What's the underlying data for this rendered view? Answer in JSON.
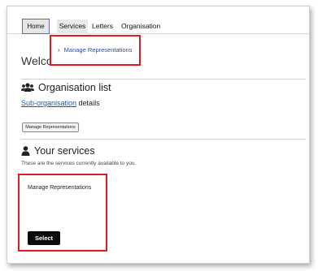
{
  "nav": {
    "items": [
      {
        "label": "Home"
      },
      {
        "label": "Services"
      },
      {
        "label": "Letters"
      },
      {
        "label": "Organisation"
      }
    ]
  },
  "dropdown": {
    "items": [
      {
        "label": "Manage Representations"
      }
    ]
  },
  "main": {
    "welcome_text": "Welco"
  },
  "organisation_section": {
    "title": "Organisation list",
    "link_text": "Sub-organisation",
    "after_link_text": " details",
    "button_label": "Manage Representations"
  },
  "services_section": {
    "title": "Your services",
    "description": "These are the services currently available to you.",
    "card": {
      "title": "Manage Representations",
      "button_label": "Select"
    }
  },
  "colors": {
    "highlight_border": "#e01a22",
    "home_border": "#6f59c9",
    "link": "#1c55b8",
    "select_button_bg": "#0c0c0c"
  }
}
